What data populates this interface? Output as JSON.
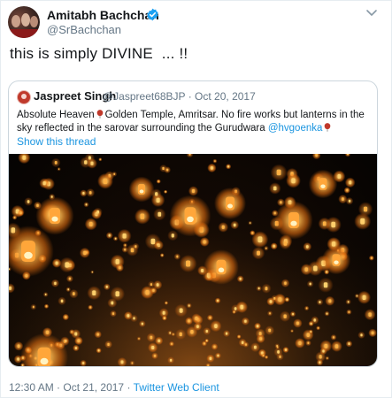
{
  "author": {
    "name": "Amitabh Bachchan",
    "handle": "@SrBachchan",
    "verified": true,
    "avatar_icon": "profile-photo"
  },
  "tweet": {
    "text": "this is simply DIVINE  ... !!"
  },
  "quoted_tweet": {
    "author_name": "Jaspreet Singh",
    "author_handle": "@Jaspreet68BJP",
    "separator": "·",
    "date": "Oct 20, 2017",
    "body_part1": "Absolute Heaven",
    "body_part2": "Golden Temple, Amritsar. No fire works but lanterns in the sky reflected in the sarovar surrounding the Gurudwara",
    "mention": "@hvgoenka",
    "show_thread": "Show this thread",
    "image_description_icon": "lanterns-photo"
  },
  "footer": {
    "time": "12:30 AM",
    "separator": "·",
    "date": "Oct 21, 2017",
    "client": "Twitter Web Client"
  },
  "colors": {
    "link": "#1b95e0",
    "secondary_text": "#657786",
    "verified": "#1da1f2",
    "heart": "#c0392b"
  }
}
